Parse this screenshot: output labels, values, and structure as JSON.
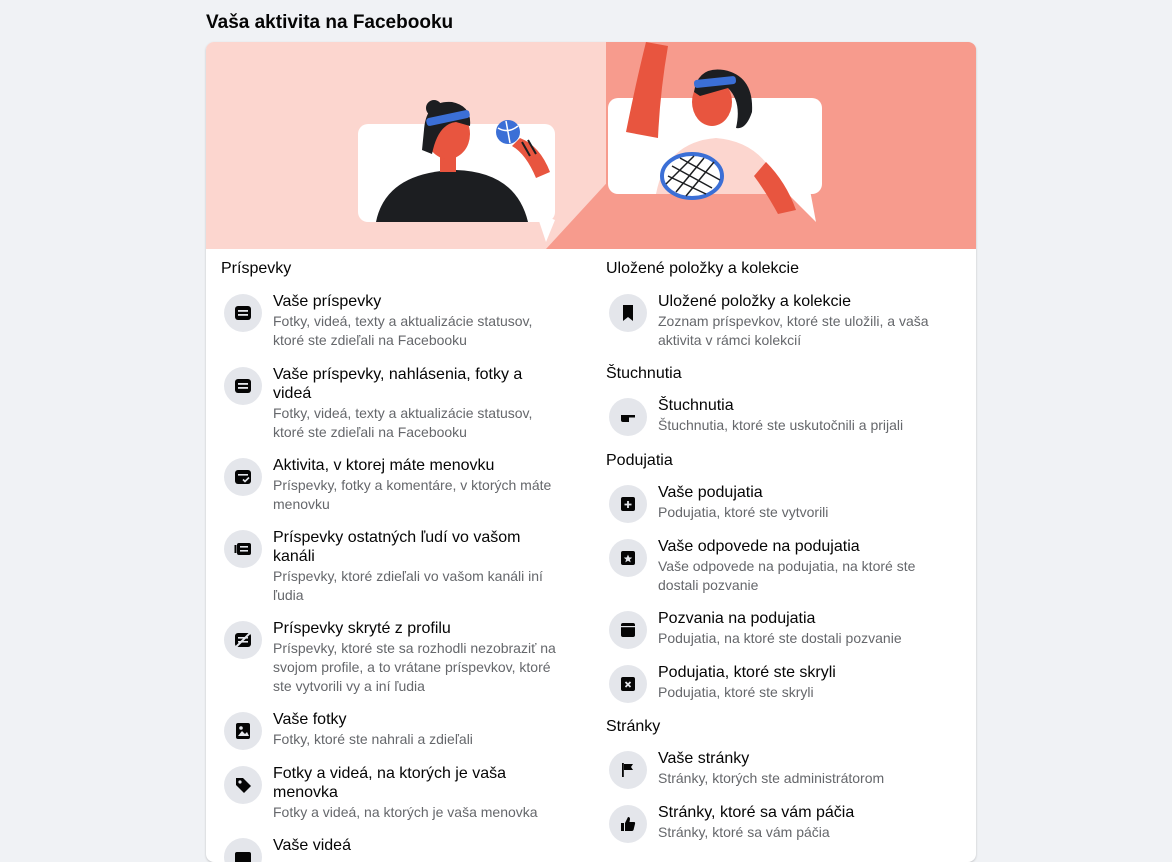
{
  "page": {
    "title": "Vaša aktivita na Facebooku"
  },
  "colors": {
    "banner_bg": "#f79b8d",
    "banner_light": "#fcd6cf",
    "icon_bg": "#e4e6eb",
    "text_secondary": "#65676b"
  },
  "left_column": {
    "section_title": "Príspevky",
    "items": [
      {
        "icon": "post-icon",
        "title": "Vaše príspevky",
        "desc": "Fotky, videá, texty a aktualizácie statusov, ktoré ste zdieľali na Facebooku"
      },
      {
        "icon": "post-icon",
        "title": "Vaše príspevky, nahlásenia, fotky a videá",
        "desc": "Fotky, videá, texty a aktualizácie statusov, ktoré ste zdieľali na Facebooku"
      },
      {
        "icon": "tagged-post-icon",
        "title": "Aktivita, v ktorej máte menovku",
        "desc": "Príspevky, fotky a komentáre, v ktorých máte menovku"
      },
      {
        "icon": "feed-posts-icon",
        "title": "Príspevky ostatných ľudí vo vašom kanáli",
        "desc": "Príspevky, ktoré zdieľali vo vašom kanáli iní ľudia"
      },
      {
        "icon": "hidden-posts-icon",
        "title": "Príspevky skryté z profilu",
        "desc": "Príspevky, ktoré ste sa rozhodli nezobraziť na svojom profile, a to vrátane príspevkov, ktoré ste vytvorili vy a iní ľudia"
      },
      {
        "icon": "photo-icon",
        "title": "Vaše fotky",
        "desc": "Fotky, ktoré ste nahrali a zdieľali"
      },
      {
        "icon": "tag-icon",
        "title": "Fotky a videá, na ktorých je vaša menovka",
        "desc": "Fotky a videá, na ktorých je vaša menovka"
      },
      {
        "icon": "video-icon",
        "title": "Vaše videá",
        "desc": ""
      }
    ]
  },
  "right_column": {
    "sections": [
      {
        "title": "Uložené položky a kolekcie",
        "items": [
          {
            "icon": "bookmark-icon",
            "title": "Uložené položky a kolekcie",
            "desc": "Zoznam príspevkov, ktoré ste uložili, a vaša aktivita v rámci kolekcií"
          }
        ]
      },
      {
        "title": "Štuchnutia",
        "items": [
          {
            "icon": "poke-icon",
            "title": "Štuchnutia",
            "desc": "Štuchnutia, ktoré ste uskutočnili a prijali"
          }
        ]
      },
      {
        "title": "Podujatia",
        "items": [
          {
            "icon": "event-add-icon",
            "title": "Vaše podujatia",
            "desc": "Podujatia, ktoré ste vytvorili"
          },
          {
            "icon": "event-star-icon",
            "title": "Vaše odpovede na podujatia",
            "desc": "Vaše odpovede na podujatia, na ktoré ste dostali pozvanie"
          },
          {
            "icon": "event-invite-icon",
            "title": "Pozvania na podujatia",
            "desc": "Podujatia, na ktoré ste dostali pozvanie"
          },
          {
            "icon": "event-hidden-icon",
            "title": "Podujatia, ktoré ste skryli",
            "desc": "Podujatia, ktoré ste skryli"
          }
        ]
      },
      {
        "title": "Stránky",
        "items": [
          {
            "icon": "flag-icon",
            "title": "Vaše stránky",
            "desc": "Stránky, ktorých ste administrátorom"
          },
          {
            "icon": "thumbs-up-icon",
            "title": "Stránky, ktoré sa vám páčia",
            "desc": "Stránky, ktoré sa vám páčia"
          }
        ]
      }
    ]
  }
}
